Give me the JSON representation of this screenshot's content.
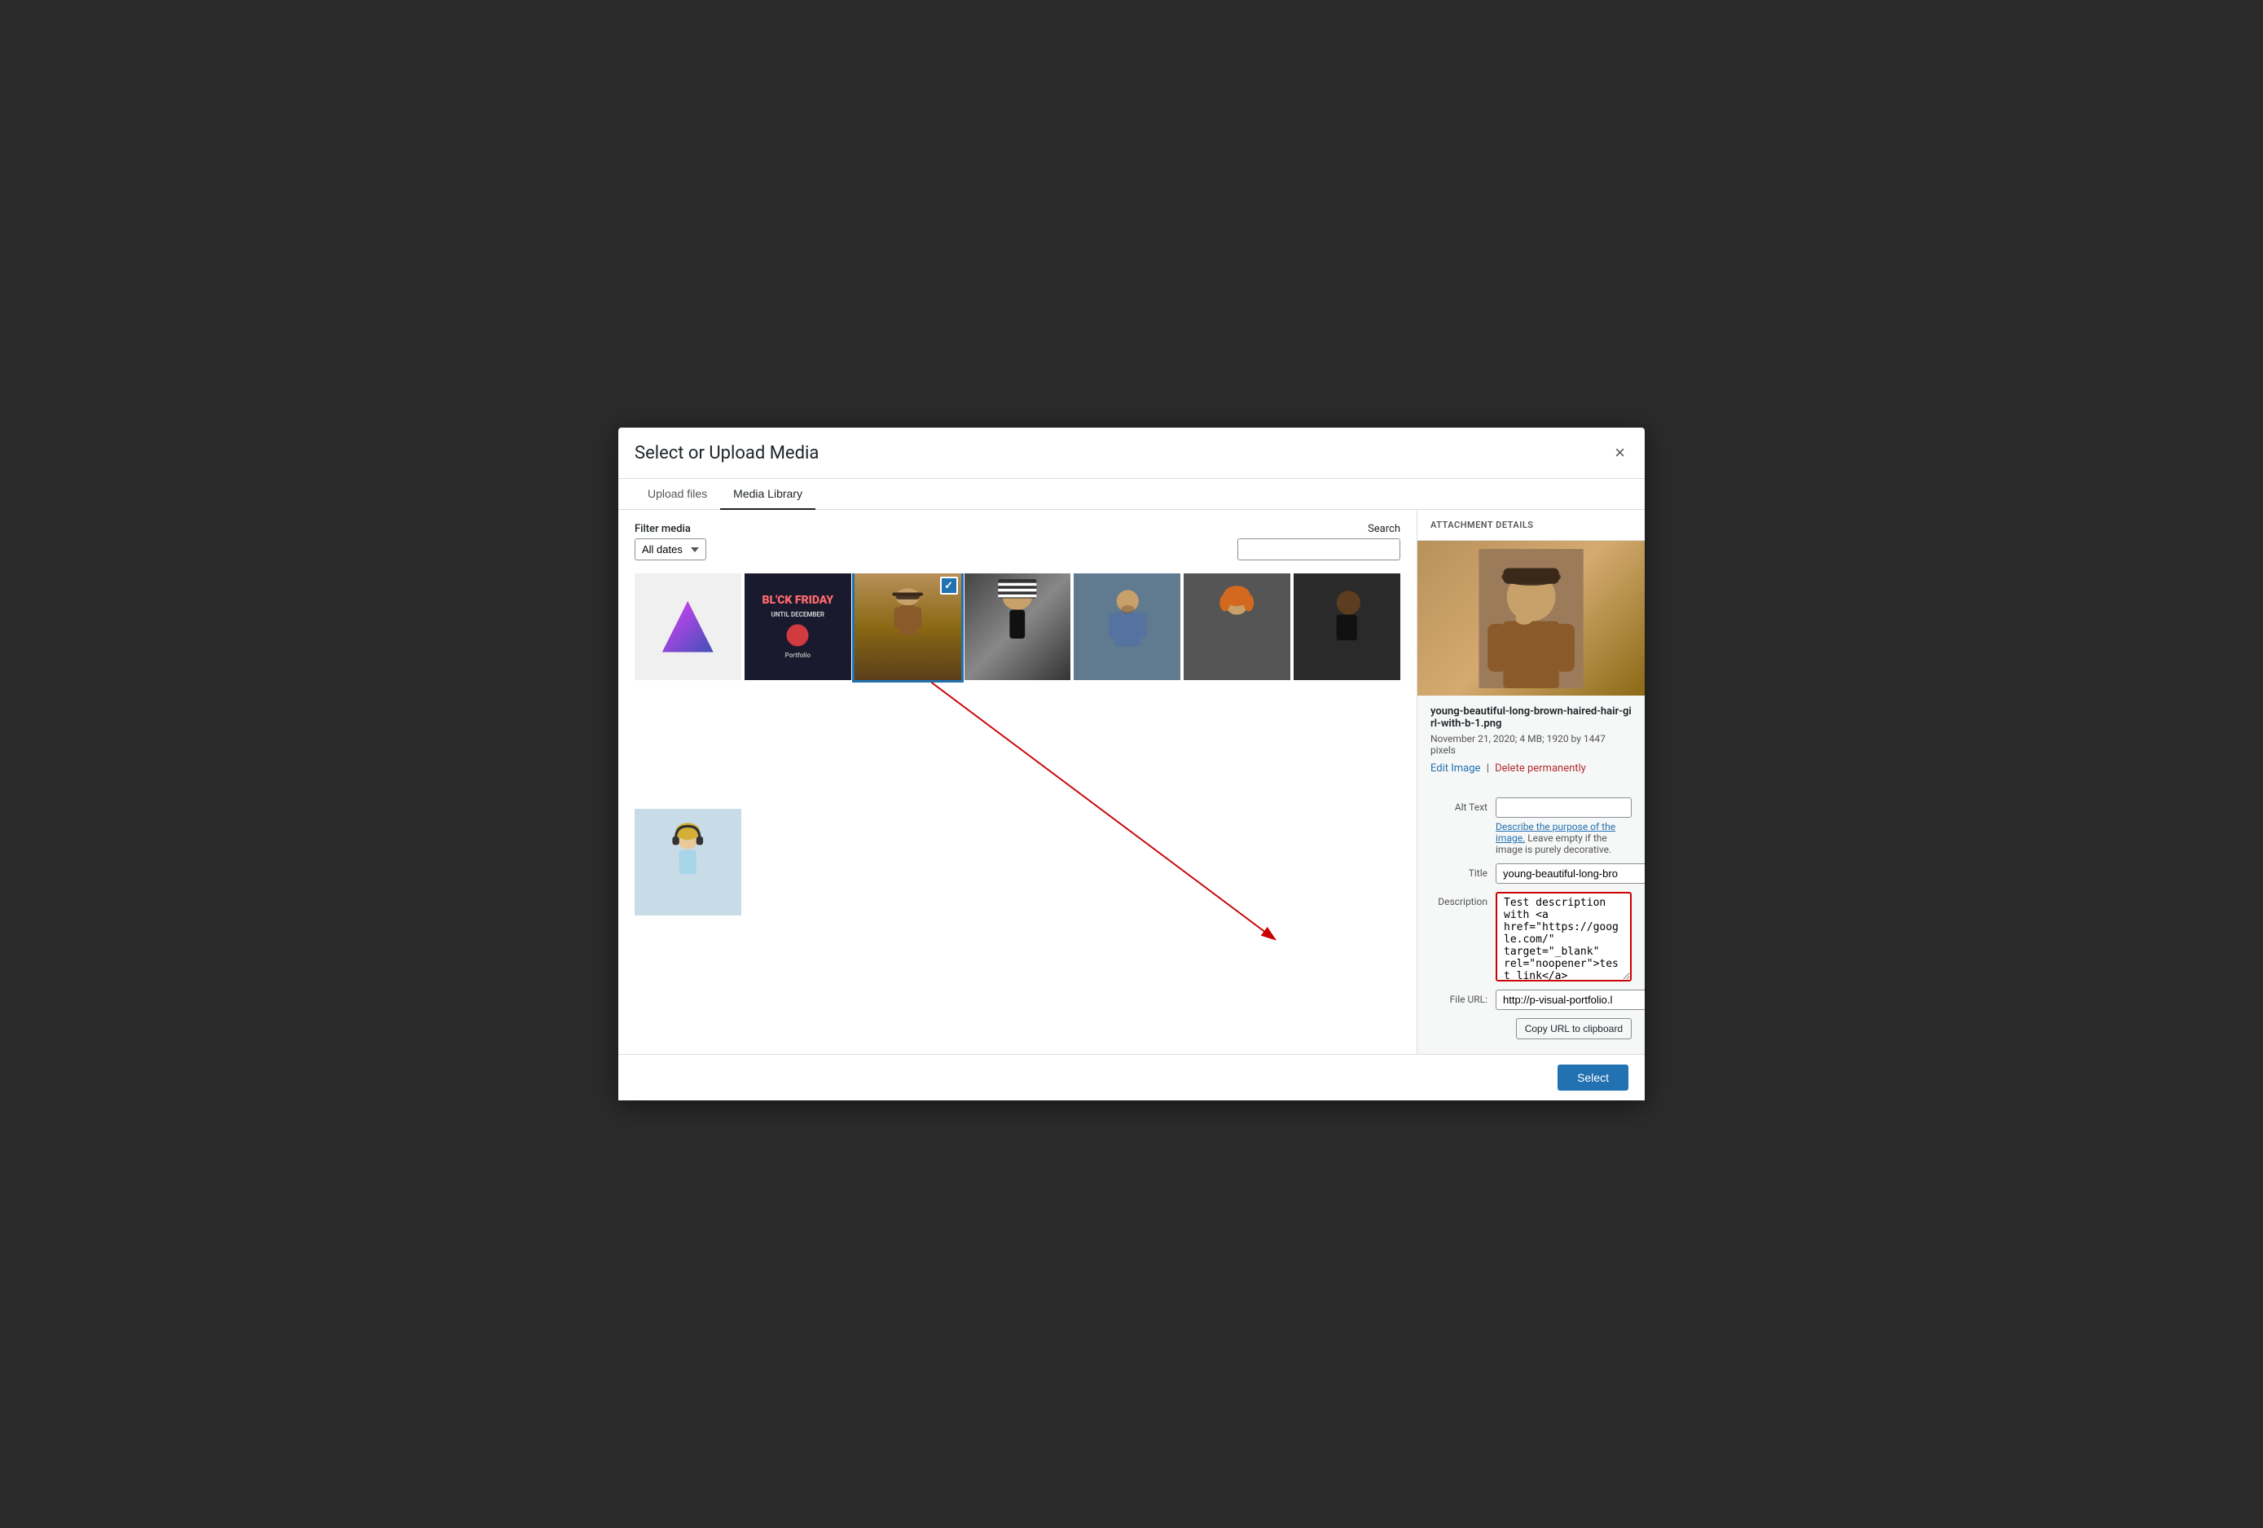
{
  "modal": {
    "title": "Select or Upload Media",
    "close_label": "×",
    "tabs": [
      {
        "id": "upload",
        "label": "Upload files",
        "active": false
      },
      {
        "id": "library",
        "label": "Media Library",
        "active": true
      }
    ]
  },
  "filter": {
    "label": "Filter media",
    "date_options": [
      "All dates"
    ],
    "date_selected": "All dates"
  },
  "search": {
    "label": "Search",
    "placeholder": ""
  },
  "attachment_panel": {
    "header": "ATTACHMENT DETAILS",
    "filename": "young-beautiful-long-brown-haired-hair-girl-with-b-1.png",
    "meta": "November 21, 2020; 4 MB; 1920 by 1447 pixels",
    "edit_image_label": "Edit Image",
    "delete_label": "Delete permanently",
    "separator": "|",
    "alt_text_label": "Alt Text",
    "alt_text_value": "",
    "describe_link": "Describe the purpose of the image.",
    "describe_text": " Leave empty if the image is purely decorative.",
    "title_label": "Title",
    "title_value": "young-beautiful-long-bro",
    "description_label": "Description",
    "description_value": "Test description with <a href=\"https://google.com/\" target=\"_blank\" rel=\"noopener\">test link</a>",
    "file_url_label": "File URL:",
    "file_url_value": "http://p-visual-portfolio.l",
    "copy_url_label": "Copy URL to clipboard"
  },
  "footer": {
    "select_label": "Select"
  },
  "media_items": [
    {
      "id": "triangle",
      "type": "triangle",
      "selected": false,
      "label": "Triangle image"
    },
    {
      "id": "black-friday",
      "type": "dark",
      "selected": false,
      "label": "Black Friday"
    },
    {
      "id": "woman-hat",
      "type": "woman-brown",
      "selected": true,
      "label": "Woman with hat"
    },
    {
      "id": "woman-striped",
      "type": "striped-woman",
      "selected": false,
      "label": "Woman striped hat"
    },
    {
      "id": "man-blue",
      "type": "man-blue",
      "selected": false,
      "label": "Man blue shirt"
    },
    {
      "id": "woman-orange",
      "type": "woman-orange",
      "selected": false,
      "label": "Woman orange hair"
    },
    {
      "id": "man-dark",
      "type": "man-dark",
      "selected": false,
      "label": "Man dark profile"
    },
    {
      "id": "woman-headphones",
      "type": "woman-headphones",
      "selected": false,
      "label": "Woman with headphones"
    }
  ]
}
